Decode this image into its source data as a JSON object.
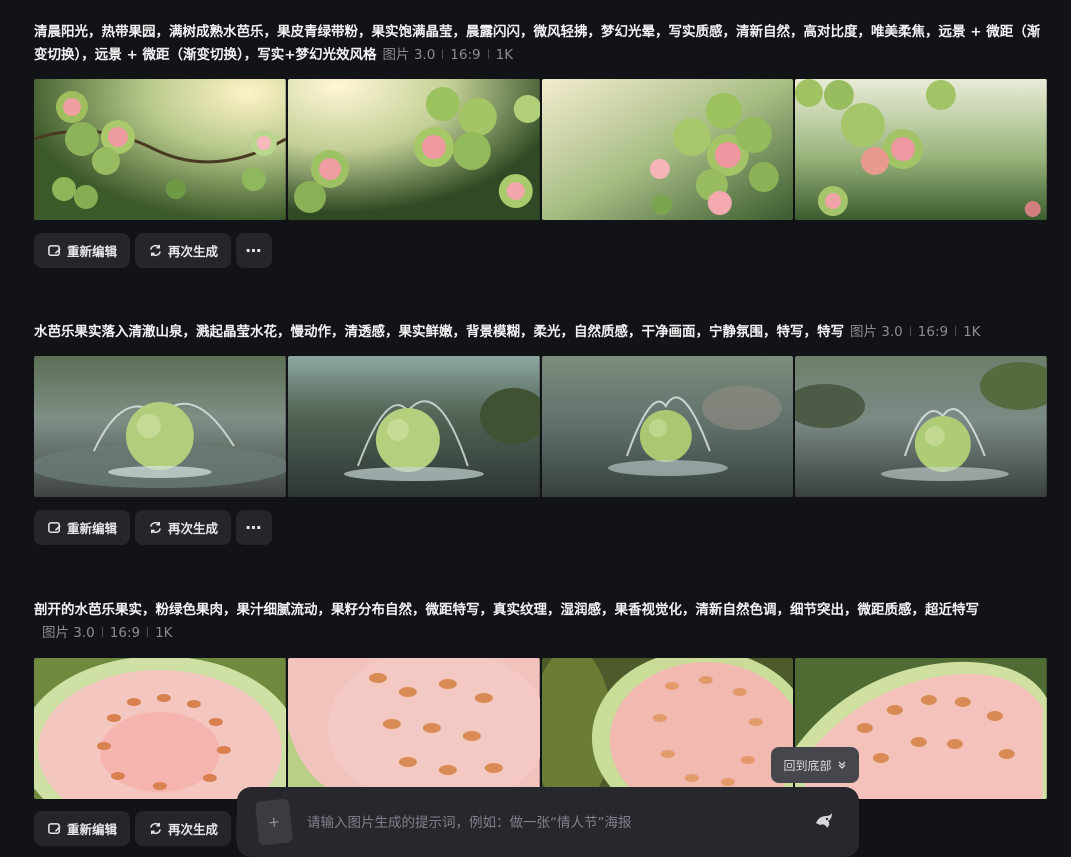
{
  "groups": [
    {
      "prompt": "清晨阳光，热带果园，满树成熟水芭乐，果皮青绿带粉，果实饱满晶莹，晨露闪闪，微风轻拂，梦幻光晕，写实质感，清新自然，高对比度，唯美柔焦，远景 + 微距（渐变切换），远景 + 微距（渐变切换），写实+梦幻光效风格",
      "meta": {
        "model": "图片 3.0",
        "ratio": "16:9",
        "resolution": "1K"
      },
      "images": [
        "guava-orchard-1",
        "guava-orchard-2",
        "guava-orchard-3",
        "guava-orchard-4"
      ],
      "actions": {
        "edit": "重新编辑",
        "regen": "再次生成",
        "more": "⋯"
      }
    },
    {
      "prompt": "水芭乐果实落入清澈山泉，溅起晶莹水花，慢动作，清透感，果实鲜嫩，背景模糊，柔光，自然质感，干净画面，宁静氛围，特写，特写",
      "meta": {
        "model": "图片 3.0",
        "ratio": "16:9",
        "resolution": "1K"
      },
      "images": [
        "guava-splash-1",
        "guava-splash-2",
        "guava-splash-3",
        "guava-splash-4"
      ],
      "actions": {
        "edit": "重新编辑",
        "regen": "再次生成",
        "more": "⋯"
      }
    },
    {
      "prompt": "剖开的水芭乐果实，粉绿色果肉，果汁细腻流动，果籽分布自然，微距特写，真实纹理，湿润感，果香视觉化，清新自然色调，细节突出，微距质感，超近特写",
      "meta": {
        "model": "图片 3.0",
        "ratio": "16:9",
        "resolution": "1K"
      },
      "images": [
        "guava-cut-1",
        "guava-cut-2",
        "guava-cut-3",
        "guava-cut-4"
      ],
      "actions": {
        "edit": "重新编辑",
        "regen": "再次生成",
        "more": "⋯"
      }
    }
  ],
  "scroll_to_bottom": "回到底部",
  "composer": {
    "placeholder": "请输入图片生成的提示词，例如：做一张“情人节”海报",
    "add_label": "+"
  },
  "colors": {
    "background": "#121316",
    "button_bg": "#24262a",
    "guava_green": "#a9c96a",
    "guava_pink": "#f0a3a3"
  }
}
